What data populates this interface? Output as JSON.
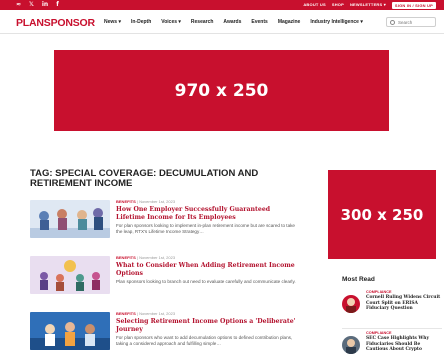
{
  "colors": {
    "brand_red": "#c8102e",
    "dark_text": "#222222",
    "muted_text": "#999999"
  },
  "topbar": {
    "social": [
      {
        "icon": "rss-icon",
        "glyph": "≈"
      },
      {
        "icon": "twitter-icon",
        "glyph": "𝕏"
      },
      {
        "icon": "linkedin-icon",
        "glyph": "in"
      },
      {
        "icon": "facebook-icon",
        "glyph": "f"
      }
    ],
    "links": [
      "ABOUT US",
      "SHOP",
      "NEWSLETTERS ▾"
    ],
    "signin": "SIGN IN / SIGN UP"
  },
  "nav": {
    "logo": "PLANSPONSOR",
    "items": [
      "News ▾",
      "In-Depth",
      "Voices ▾",
      "Research",
      "Awards",
      "Events",
      "Magazine",
      "Industry Intelligence ▾"
    ],
    "search_placeholder": "Search"
  },
  "ads": {
    "top": "970 x 250",
    "side": "300 x 250"
  },
  "tag_title": "TAG: SPECIAL COVERAGE: DECUMULATION AND RETIREMENT INCOME",
  "articles": [
    {
      "category": "BENEFITS",
      "date": "November 1st, 2023",
      "title": "How One Employer Successfully Guaranteed Lifetime Income for Its Employees",
      "desc": "For plan sponsors looking to implement in-plan retirement income but are scared to take the leap, RTX's Lifetime Income Strategy…"
    },
    {
      "category": "BENEFITS",
      "date": "November 1st, 2023",
      "title": "What to Consider When Adding Retirement Income Options",
      "desc": "Plan sponsors looking to branch out need to evaluate carefully and communicate clearly."
    },
    {
      "category": "BENEFITS",
      "date": "November 1st, 2023",
      "title": "Selecting Retirement Income Options a 'Deliberate' Journey",
      "desc": "For plan sponsors who want to add decumulation options to defined contribution plans, taking a considered approach and fulfilling simple…"
    }
  ],
  "most_read": {
    "heading": "Most Read",
    "items": [
      {
        "category": "COMPLIANCE",
        "title": "Cornell Ruling Widens Circuit Court Split on ERISA Fiduciary Question"
      },
      {
        "category": "COMPLIANCE",
        "title": "SEC Case Highlights Why Fiduciaries Should Be Cautious About Crypto"
      }
    ]
  }
}
